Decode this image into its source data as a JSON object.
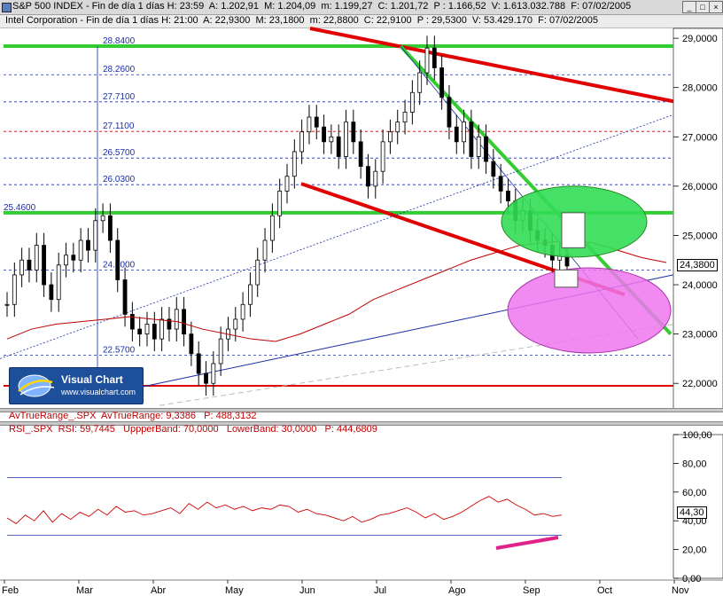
{
  "window": {
    "title": "S&P 500 INDEX - Fin de día 1 días H: 23:59  A: 1.202,91  M: 1.204,09  m: 1.199,27  C: 1.201,72  P : 1.166,52  V: 1.613.032.788  F: 07/02/2005",
    "subtitle": "Intel Corporation - Fin de día 1 días H: 21:00  A: 22,9300  M: 23,1800  m: 22,8800  C: 22,9100  P : 29,5300  V: 53.429.170  F: 07/02/2005",
    "minimize": "_",
    "maximize": "□",
    "close": "×"
  },
  "logo": {
    "name": "Visual Chart",
    "url": "www.visualchart.com"
  },
  "panels": {
    "atr_header": "AvTrueRange_.SPX  AvTrueRange: 9,3386   P: 488,3132",
    "rsi_header": "RSI_.SPX  RSI: 59,7445   UppperBand: 70,0000   LowerBand: 30,0000   P: 444,6809"
  },
  "chart_data": [
    {
      "type": "line",
      "title": "Intel Corporation",
      "x_labels": [
        "Feb",
        "Mar",
        "Abr",
        "May",
        "Jun",
        "Jul",
        "Ago",
        "Sep",
        "Oct",
        "Nov"
      ],
      "y_ticks": [
        "29,0000",
        "28,0000",
        "27,0000",
        "26,0000",
        "25,0000",
        "24,0000",
        "23,0000",
        "22,0000"
      ],
      "ylim": [
        21.5,
        29.2
      ],
      "last_price": "24,3800",
      "fib_levels": [
        {
          "label": "28.8400",
          "value": 28.84
        },
        {
          "label": "28.2600",
          "value": 28.26
        },
        {
          "label": "27.7100",
          "value": 27.71
        },
        {
          "label": "27.1100",
          "value": 27.11
        },
        {
          "label": "26.5700",
          "value": 26.57
        },
        {
          "label": "26.0300",
          "value": 26.03
        },
        {
          "label": "25.4600",
          "value": 25.46
        },
        {
          "label": "24.3000",
          "value": 24.3
        },
        {
          "label": "22.5700",
          "value": 22.57
        }
      ],
      "close_series": [
        23.6,
        24.2,
        24.5,
        24.3,
        24.8,
        24.0,
        23.7,
        24.4,
        24.6,
        24.5,
        24.9,
        24.7,
        25.3,
        25.4,
        24.9,
        24.1,
        23.4,
        23.1,
        23.0,
        23.2,
        22.9,
        23.3,
        23.1,
        23.5,
        23.0,
        22.6,
        22.2,
        22.0,
        22.4,
        22.9,
        23.1,
        23.3,
        23.6,
        24.0,
        24.5,
        24.9,
        25.4,
        25.9,
        26.2,
        26.7,
        27.1,
        27.4,
        27.2,
        26.9,
        27.0,
        26.6,
        27.3,
        26.9,
        26.4,
        26.0,
        26.3,
        26.9,
        27.1,
        27.3,
        27.5,
        27.9,
        28.3,
        28.8,
        28.4,
        27.8,
        27.2,
        26.9,
        27.3,
        26.6,
        27.0,
        26.5,
        26.2,
        25.9,
        25.7,
        25.3,
        25.5,
        25.1,
        24.9,
        24.8,
        24.5,
        24.6,
        24.38
      ],
      "moving_average": [
        22.9,
        23.1,
        23.2,
        23.25,
        23.3,
        23.35,
        23.3,
        23.25,
        23.1,
        23.0,
        22.9,
        22.85,
        23.0,
        23.2,
        23.4,
        23.7,
        23.9,
        24.1,
        24.3,
        24.5,
        24.65,
        24.8,
        24.85,
        24.9,
        24.85,
        24.7,
        24.55,
        24.45
      ],
      "rsi": [
        42,
        38,
        44,
        40,
        47,
        39,
        45,
        41,
        46,
        43,
        48,
        44,
        50,
        46,
        47,
        44,
        45,
        47,
        49,
        45,
        52,
        48,
        53,
        49,
        51,
        48,
        50,
        47,
        49,
        48,
        51,
        50,
        46,
        48,
        45,
        44,
        42,
        40,
        43,
        39,
        41,
        44,
        45,
        47,
        49,
        46,
        42,
        45,
        41,
        43,
        46,
        50,
        54,
        57,
        53,
        55,
        51,
        48,
        44,
        45,
        43,
        44
      ],
      "rsi_ticks": [
        "100,00",
        "80,00",
        "60,00",
        "40,00",
        "20,00",
        "0,00"
      ],
      "rsi_last": "44,30",
      "rsi_bands": [
        70,
        30
      ]
    }
  ]
}
